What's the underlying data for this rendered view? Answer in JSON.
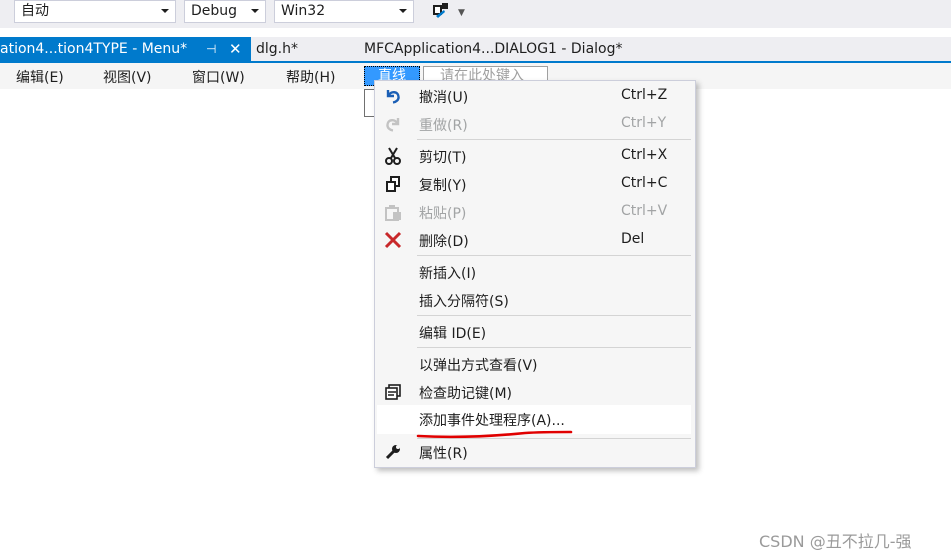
{
  "toolbar": {
    "config_combo": "自动",
    "build_combo": "Debug",
    "platform_combo": "Win32",
    "tool_icon": "attach-process-icon"
  },
  "tabs": {
    "active": "ation4...tion4TYPE - Menu*",
    "active_pin": "⊣",
    "active_close": "✕",
    "tab2": "dlg.h*",
    "tab3": "MFCApplication4...DIALOG1 - Dialog*"
  },
  "menu_editor": {
    "items": [
      "编辑(E)",
      "视图(V)",
      "窗口(W)",
      "帮助(H)"
    ],
    "selected_item": "直线",
    "type_here": "请在此处键入"
  },
  "context_menu": {
    "items": [
      {
        "icon": "undo-icon",
        "label": "撤消(U)",
        "shortcut": "Ctrl+Z",
        "enabled": true
      },
      {
        "icon": "redo-icon",
        "label": "重做(R)",
        "shortcut": "Ctrl+Y",
        "enabled": false
      },
      {
        "icon": "cut-icon",
        "label": "剪切(T)",
        "shortcut": "Ctrl+X",
        "enabled": true
      },
      {
        "icon": "copy-icon",
        "label": "复制(Y)",
        "shortcut": "Ctrl+C",
        "enabled": true
      },
      {
        "icon": "paste-icon",
        "label": "粘贴(P)",
        "shortcut": "Ctrl+V",
        "enabled": false
      },
      {
        "icon": "delete-icon",
        "label": "删除(D)",
        "shortcut": "Del",
        "enabled": true
      },
      {
        "icon": "",
        "label": "新插入(I)",
        "shortcut": "",
        "enabled": true
      },
      {
        "icon": "",
        "label": "插入分隔符(S)",
        "shortcut": "",
        "enabled": true
      },
      {
        "icon": "",
        "label": "编辑 ID(E)",
        "shortcut": "",
        "enabled": true
      },
      {
        "icon": "",
        "label": "以弹出方式查看(V)",
        "shortcut": "",
        "enabled": true
      },
      {
        "icon": "check-mnemonics-icon",
        "label": "检查助记键(M)",
        "shortcut": "",
        "enabled": true
      },
      {
        "icon": "",
        "label": "添加事件处理程序(A)...",
        "shortcut": "",
        "enabled": true
      },
      {
        "icon": "wrench-icon",
        "label": "属性(R)",
        "shortcut": "",
        "enabled": true
      }
    ]
  },
  "watermark": "CSDN @丑不拉几-强",
  "colors": {
    "accent": "#007acc",
    "selected": "#3399ff",
    "annotation": "#e00000",
    "delete": "#c8282a",
    "icon": "#1e1e1e"
  }
}
